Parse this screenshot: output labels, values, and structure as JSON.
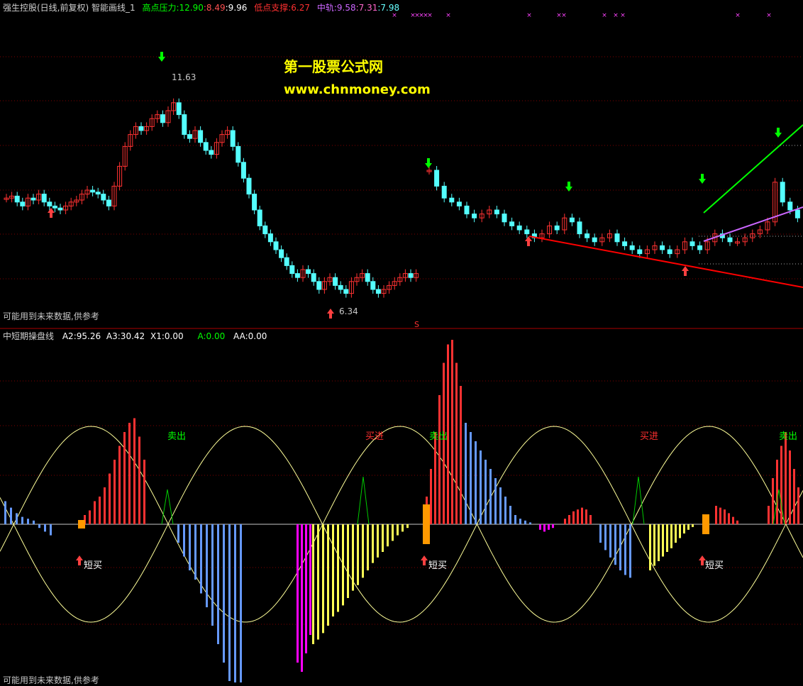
{
  "top": {
    "title": "强生控股(日线,前复权) 智能画线_1",
    "high_label": "高点压力:",
    "high_values": [
      "12.90",
      ":8.49",
      ":9.96"
    ],
    "low_label": "低点支撑:",
    "low_values": [
      "6.27"
    ],
    "mid_label": "中轨:",
    "mid_values": [
      "9.58",
      ":7.31",
      ":7.98"
    ],
    "peak_label": "11.63",
    "trough_label": "6.34",
    "note": "可能用到未来数据,供参考",
    "s_marker": "S",
    "x_marker": "×"
  },
  "watermark": {
    "name": "第一股票公式网",
    "url": "www.chnmoney.com"
  },
  "bottom": {
    "title": "中短期操盘线",
    "a2": "A2:95.26",
    "a3": "A3:30.42",
    "x1": "X1:0.00",
    "a": "A:0.00",
    "aa": "AA:0.00",
    "note": "可能用到未来数据,供参考",
    "sell_label": "卖出",
    "buy_label": "买进",
    "short_buy_label": "短买"
  },
  "colors": {
    "up": "#ff3232",
    "down": "#54ffff",
    "support": "#ff0000",
    "resist": "#00ff00",
    "mid": "#cc66ff",
    "sine": "#ffff99",
    "zero": "#c8c8c8",
    "magenta": "#ff00ff",
    "yellow": "#ffff55",
    "orange": "#ff9900",
    "lightblue": "#6699ff"
  }
}
